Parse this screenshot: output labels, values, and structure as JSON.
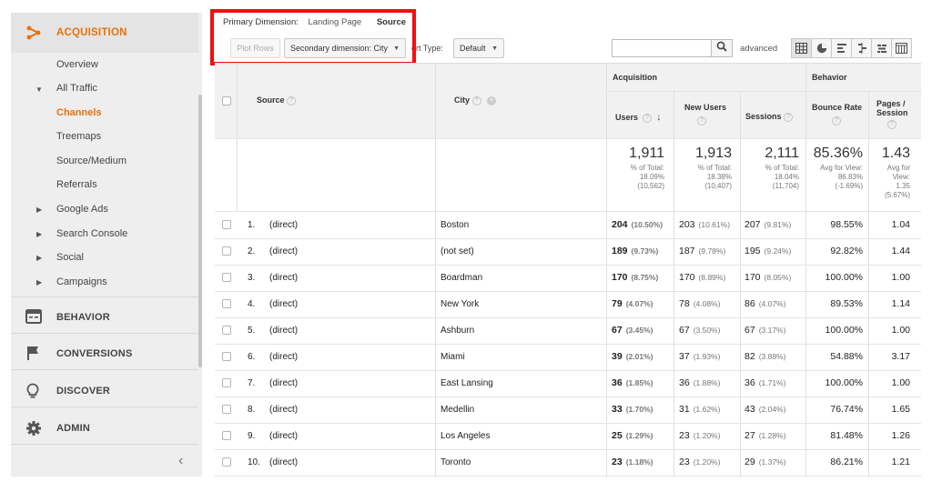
{
  "sidebar": {
    "acquisition_label": "ACQUISITION",
    "items": [
      {
        "label": "Overview"
      },
      {
        "label": "All Traffic"
      },
      {
        "label": "Channels"
      },
      {
        "label": "Treemaps"
      },
      {
        "label": "Source/Medium"
      },
      {
        "label": "Referrals"
      },
      {
        "label": "Google Ads"
      },
      {
        "label": "Search Console"
      },
      {
        "label": "Social"
      },
      {
        "label": "Campaigns"
      }
    ],
    "sections": [
      {
        "label": "BEHAVIOR"
      },
      {
        "label": "CONVERSIONS"
      },
      {
        "label": "DISCOVER"
      },
      {
        "label": "ADMIN"
      }
    ],
    "accent_color": "#e8710a"
  },
  "controls": {
    "primary_dimension_label": "Primary Dimension:",
    "primary_options": [
      "Landing Page",
      "Source"
    ],
    "plot_rows": "Plot Rows",
    "secondary_dimension": "Secondary dimension: City",
    "sort_type_label": "ort Type:",
    "sort_default": "Default",
    "advanced": "advanced",
    "highlight_color": "#ee1111"
  },
  "table": {
    "headers": {
      "source": "Source",
      "city": "City",
      "acquisition": "Acquisition",
      "behavior": "Behavior",
      "users": "Users",
      "new_users": "New Users",
      "sessions": "Sessions",
      "bounce_rate": "Bounce Rate",
      "pages_session_1": "Pages /",
      "pages_session_2": "Session"
    },
    "totals": {
      "users": {
        "value": "1,911",
        "l1": "% of Total:",
        "l2": "18.09%",
        "l3": "(10,562)"
      },
      "new_users": {
        "value": "1,913",
        "l1": "% of Total:",
        "l2": "18.38%",
        "l3": "(10,407)"
      },
      "sessions": {
        "value": "2,111",
        "l1": "% of Total:",
        "l2": "18.04%",
        "l3": "(11,704)"
      },
      "bounce_rate": {
        "value": "85.36%",
        "l1": "Avg for View:",
        "l2": "86.83%",
        "l3": "(-1.69%)"
      },
      "pages_session": {
        "value": "1.43",
        "l1": "Avg for",
        "l2": "View:",
        "l3": "1.35",
        "l4": "(5.67%)"
      }
    },
    "rows": [
      {
        "n": "1.",
        "source": "(direct)",
        "city": "Boston",
        "users": "204",
        "users_pct": "(10.50%)",
        "new_users": "203",
        "new_users_pct": "(10.61%)",
        "sessions": "207",
        "sessions_pct": "(9.81%)",
        "bounce": "98.55%",
        "pages": "1.04"
      },
      {
        "n": "2.",
        "source": "(direct)",
        "city": "(not set)",
        "users": "189",
        "users_pct": "(9.73%)",
        "new_users": "187",
        "new_users_pct": "(9.78%)",
        "sessions": "195",
        "sessions_pct": "(9.24%)",
        "bounce": "92.82%",
        "pages": "1.44"
      },
      {
        "n": "3.",
        "source": "(direct)",
        "city": "Boardman",
        "users": "170",
        "users_pct": "(8.75%)",
        "new_users": "170",
        "new_users_pct": "(8.89%)",
        "sessions": "170",
        "sessions_pct": "(8.05%)",
        "bounce": "100.00%",
        "pages": "1.00"
      },
      {
        "n": "4.",
        "source": "(direct)",
        "city": "New York",
        "users": "79",
        "users_pct": "(4.07%)",
        "new_users": "78",
        "new_users_pct": "(4.08%)",
        "sessions": "86",
        "sessions_pct": "(4.07%)",
        "bounce": "89.53%",
        "pages": "1.14"
      },
      {
        "n": "5.",
        "source": "(direct)",
        "city": "Ashburn",
        "users": "67",
        "users_pct": "(3.45%)",
        "new_users": "67",
        "new_users_pct": "(3.50%)",
        "sessions": "67",
        "sessions_pct": "(3.17%)",
        "bounce": "100.00%",
        "pages": "1.00"
      },
      {
        "n": "6.",
        "source": "(direct)",
        "city": "Miami",
        "users": "39",
        "users_pct": "(2.01%)",
        "new_users": "37",
        "new_users_pct": "(1.93%)",
        "sessions": "82",
        "sessions_pct": "(3.88%)",
        "bounce": "54.88%",
        "pages": "3.17"
      },
      {
        "n": "7.",
        "source": "(direct)",
        "city": "East Lansing",
        "users": "36",
        "users_pct": "(1.85%)",
        "new_users": "36",
        "new_users_pct": "(1.88%)",
        "sessions": "36",
        "sessions_pct": "(1.71%)",
        "bounce": "100.00%",
        "pages": "1.00"
      },
      {
        "n": "8.",
        "source": "(direct)",
        "city": "Medellin",
        "users": "33",
        "users_pct": "(1.70%)",
        "new_users": "31",
        "new_users_pct": "(1.62%)",
        "sessions": "43",
        "sessions_pct": "(2.04%)",
        "bounce": "76.74%",
        "pages": "1.65"
      },
      {
        "n": "9.",
        "source": "(direct)",
        "city": "Los Angeles",
        "users": "25",
        "users_pct": "(1.29%)",
        "new_users": "23",
        "new_users_pct": "(1.20%)",
        "sessions": "27",
        "sessions_pct": "(1.28%)",
        "bounce": "81.48%",
        "pages": "1.26"
      },
      {
        "n": "10.",
        "source": "(direct)",
        "city": "Toronto",
        "users": "23",
        "users_pct": "(1.18%)",
        "new_users": "23",
        "new_users_pct": "(1.20%)",
        "sessions": "29",
        "sessions_pct": "(1.37%)",
        "bounce": "86.21%",
        "pages": "1.21"
      }
    ]
  }
}
